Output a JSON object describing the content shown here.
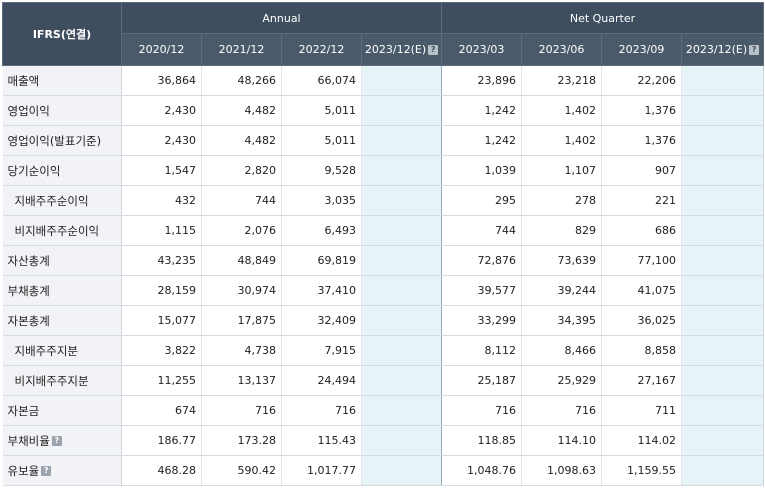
{
  "header": {
    "corner": "IFRS(연결)",
    "annual": "Annual",
    "quarter": "Net Quarter",
    "help_glyph": "?",
    "periods": [
      "2020/12",
      "2021/12",
      "2022/12",
      "2023/12(E)",
      "2023/03",
      "2023/06",
      "2023/09",
      "2023/12(E)"
    ]
  },
  "rows": [
    {
      "label": "매출액",
      "values": [
        "36,864",
        "48,266",
        "66,074",
        "",
        "23,896",
        "23,218",
        "22,206",
        ""
      ]
    },
    {
      "label": "영업이익",
      "values": [
        "2,430",
        "4,482",
        "5,011",
        "",
        "1,242",
        "1,402",
        "1,376",
        ""
      ]
    },
    {
      "label": "영업이익(발표기준)",
      "values": [
        "2,430",
        "4,482",
        "5,011",
        "",
        "1,242",
        "1,402",
        "1,376",
        ""
      ]
    },
    {
      "label": "당기순이익",
      "values": [
        "1,547",
        "2,820",
        "9,528",
        "",
        "1,039",
        "1,107",
        "907",
        ""
      ]
    },
    {
      "label": "지배주주순이익",
      "values": [
        "432",
        "744",
        "3,035",
        "",
        "295",
        "278",
        "221",
        ""
      ]
    },
    {
      "label": "비지배주주순이익",
      "values": [
        "1,115",
        "2,076",
        "6,493",
        "",
        "744",
        "829",
        "686",
        ""
      ]
    },
    {
      "label": "자산총계",
      "values": [
        "43,235",
        "48,849",
        "69,819",
        "",
        "72,876",
        "73,639",
        "77,100",
        ""
      ]
    },
    {
      "label": "부채총계",
      "values": [
        "28,159",
        "30,974",
        "37,410",
        "",
        "39,577",
        "39,244",
        "41,075",
        ""
      ]
    },
    {
      "label": "자본총계",
      "values": [
        "15,077",
        "17,875",
        "32,409",
        "",
        "33,299",
        "34,395",
        "36,025",
        ""
      ]
    },
    {
      "label": "지배주주지분",
      "values": [
        "3,822",
        "4,738",
        "7,915",
        "",
        "8,112",
        "8,466",
        "8,858",
        ""
      ]
    },
    {
      "label": "비지배주주지분",
      "values": [
        "11,255",
        "13,137",
        "24,494",
        "",
        "25,187",
        "25,929",
        "27,167",
        ""
      ]
    },
    {
      "label": "자본금",
      "values": [
        "674",
        "716",
        "716",
        "",
        "716",
        "716",
        "711",
        ""
      ]
    },
    {
      "label": "부채비율",
      "values": [
        "186.77",
        "173.28",
        "115.43",
        "",
        "118.85",
        "114.10",
        "114.02",
        ""
      ]
    },
    {
      "label": "유보율",
      "values": [
        "468.28",
        "590.42",
        "1,017.77",
        "",
        "1,048.76",
        "1,098.63",
        "1,159.55",
        ""
      ]
    }
  ]
}
